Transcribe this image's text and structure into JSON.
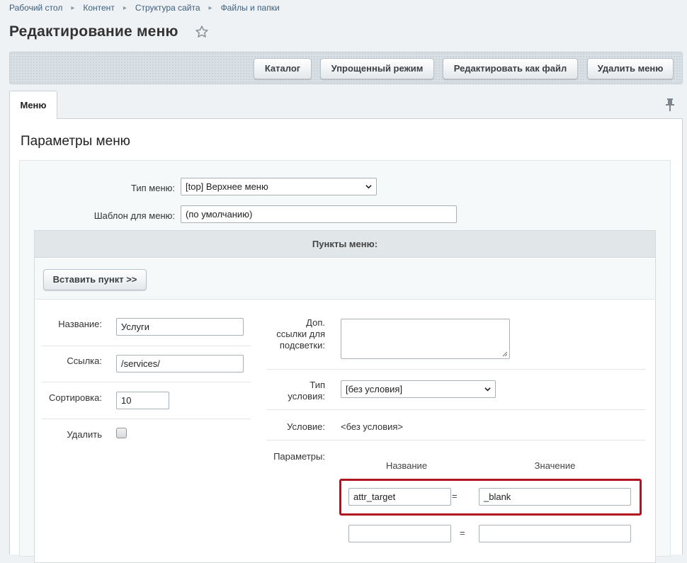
{
  "breadcrumb": {
    "items": [
      "Рабочий стол",
      "Контент",
      "Структура сайта",
      "Файлы и папки"
    ],
    "separator": "▸"
  },
  "page": {
    "title": "Редактирование меню",
    "favorite_icon": "star-icon"
  },
  "toolbar": {
    "catalog": "Каталог",
    "simple_mode": "Упрощенный режим",
    "edit_as_file": "Редактировать как файл",
    "delete_menu": "Удалить меню"
  },
  "tabs": [
    {
      "label": "Меню",
      "active": true
    }
  ],
  "pin_icon": "pin-icon",
  "section": {
    "title": "Параметры меню"
  },
  "form": {
    "menu_type_label": "Тип меню:",
    "menu_type_value": "[top] Верхнее меню",
    "template_label": "Шаблон для меню:",
    "template_value": "(по умолчанию)"
  },
  "items": {
    "header": "Пункты меню:",
    "insert_button": "Вставить пункт >>",
    "name_label": "Название:",
    "name_value": "Услуги",
    "link_label": "Ссылка:",
    "link_value": "/services/",
    "sort_label": "Сортировка:",
    "sort_value": "10",
    "delete_label": "Удалить",
    "delete_checked": false,
    "extra_links_label_1": "Доп.",
    "extra_links_label_2": "ссылки для",
    "extra_links_label_3": "подсветки:",
    "condition_type_label_1": "Тип",
    "condition_type_label_2": "условия:",
    "condition_type_value": "[без условия]",
    "condition_label": "Условие:",
    "condition_value": "<без условия>",
    "params_label": "Параметры:",
    "params_col_name": "Название",
    "params_col_value": "Значение",
    "params_eq": "=",
    "params": [
      {
        "name": "attr_target",
        "value": "_blank"
      },
      {
        "name": "",
        "value": ""
      }
    ]
  },
  "colors": {
    "highlight": "#b0141c",
    "breadcrumb_link": "#3f5e7c"
  }
}
